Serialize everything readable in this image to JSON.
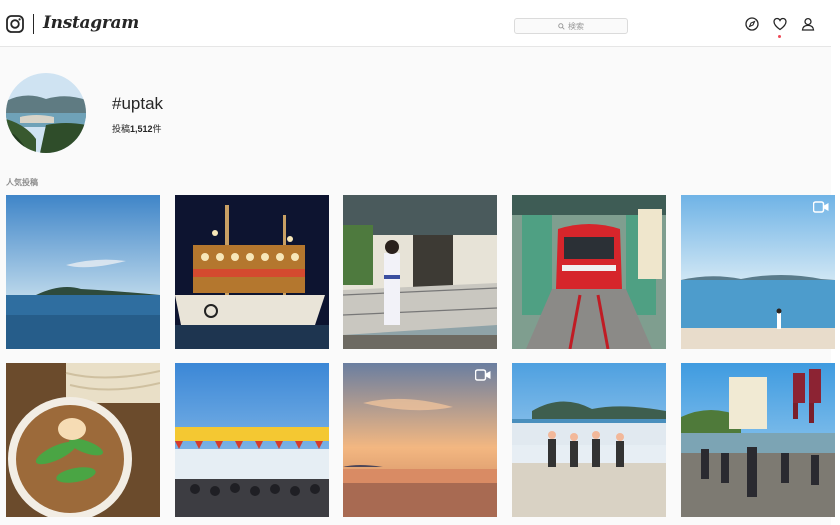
{
  "header": {
    "logo_text": "Instagram",
    "search_placeholder": "検索"
  },
  "profile": {
    "hashtag": "#uptak",
    "posts_prefix": "投稿",
    "posts_count": "1,512",
    "posts_suffix": "件"
  },
  "section": {
    "popular_label": "人気投稿"
  },
  "posts": [
    {
      "subject": "sea-horizon-island",
      "video": false
    },
    {
      "subject": "festival-boat-night",
      "video": false
    },
    {
      "subject": "yukata-woman-house",
      "video": false
    },
    {
      "subject": "red-funicular-train",
      "video": false
    },
    {
      "subject": "beach-person-islands",
      "video": true
    },
    {
      "subject": "udon-noodle-bowl",
      "video": false
    },
    {
      "subject": "outdoor-festival-stage",
      "video": false
    },
    {
      "subject": "sunset-sea",
      "video": true
    },
    {
      "subject": "uptak-sign-people",
      "video": false
    },
    {
      "subject": "procession-flags",
      "video": false
    }
  ],
  "colors": {
    "notification": "#ed4956",
    "border": "#e6e6e6",
    "text": "#262626",
    "muted": "#8e8e8e"
  }
}
